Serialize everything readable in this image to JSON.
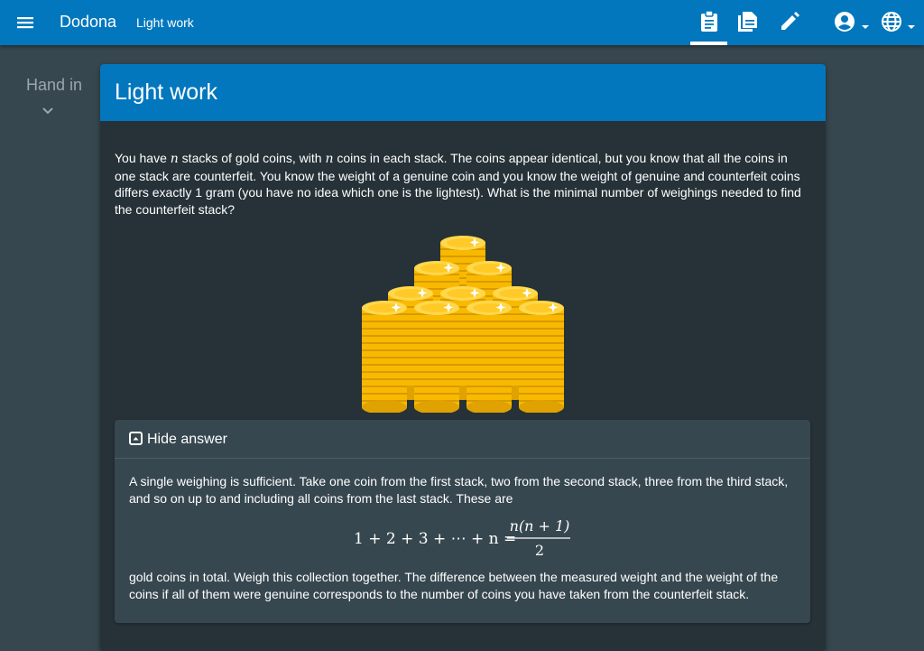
{
  "header": {
    "brand": "Dodona",
    "breadcrumb": "Light work",
    "icons": [
      "menu-icon",
      "clipboard-icon",
      "document-icon",
      "pencil-icon",
      "account-icon",
      "globe-icon"
    ]
  },
  "sidebar": {
    "label": "Hand in"
  },
  "exercise": {
    "title": "Light work",
    "question_parts": [
      "You have ",
      "n",
      " stacks of gold coins, with ",
      "n",
      " coins in each stack. The coins appear identical, but you know that all the coins in one stack are counterfeit. You know the weight of a genuine coin and you know the weight of genuine and counterfeit coins differs exactly 1 gram (you have no idea which one is the lightest). What is the minimal number of weighings needed to find the counterfeit stack?"
    ],
    "image_icon": "gold-coins-image"
  },
  "answer": {
    "toggle_label": "Hide answer",
    "paragraph1": "A single weighing is sufficient. Take one coin from the first stack, two from the second stack, three from the third stack, and so on up to and including all coins from the last stack. These are",
    "formula_left": "1 + 2 + 3 + ⋯ + n =",
    "formula_numerator": "n(n + 1)",
    "formula_denominator": "2",
    "paragraph2": "gold coins in total. Weigh this collection together. The difference between the measured weight and the weight of the coins if all of them were genuine corresponds to the number of coins you have taken from the counterfeit stack."
  },
  "colors": {
    "primary": "#0277bd",
    "page_background": "#37474f",
    "card_background": "#263238",
    "coin_gold": "#ffca28"
  }
}
